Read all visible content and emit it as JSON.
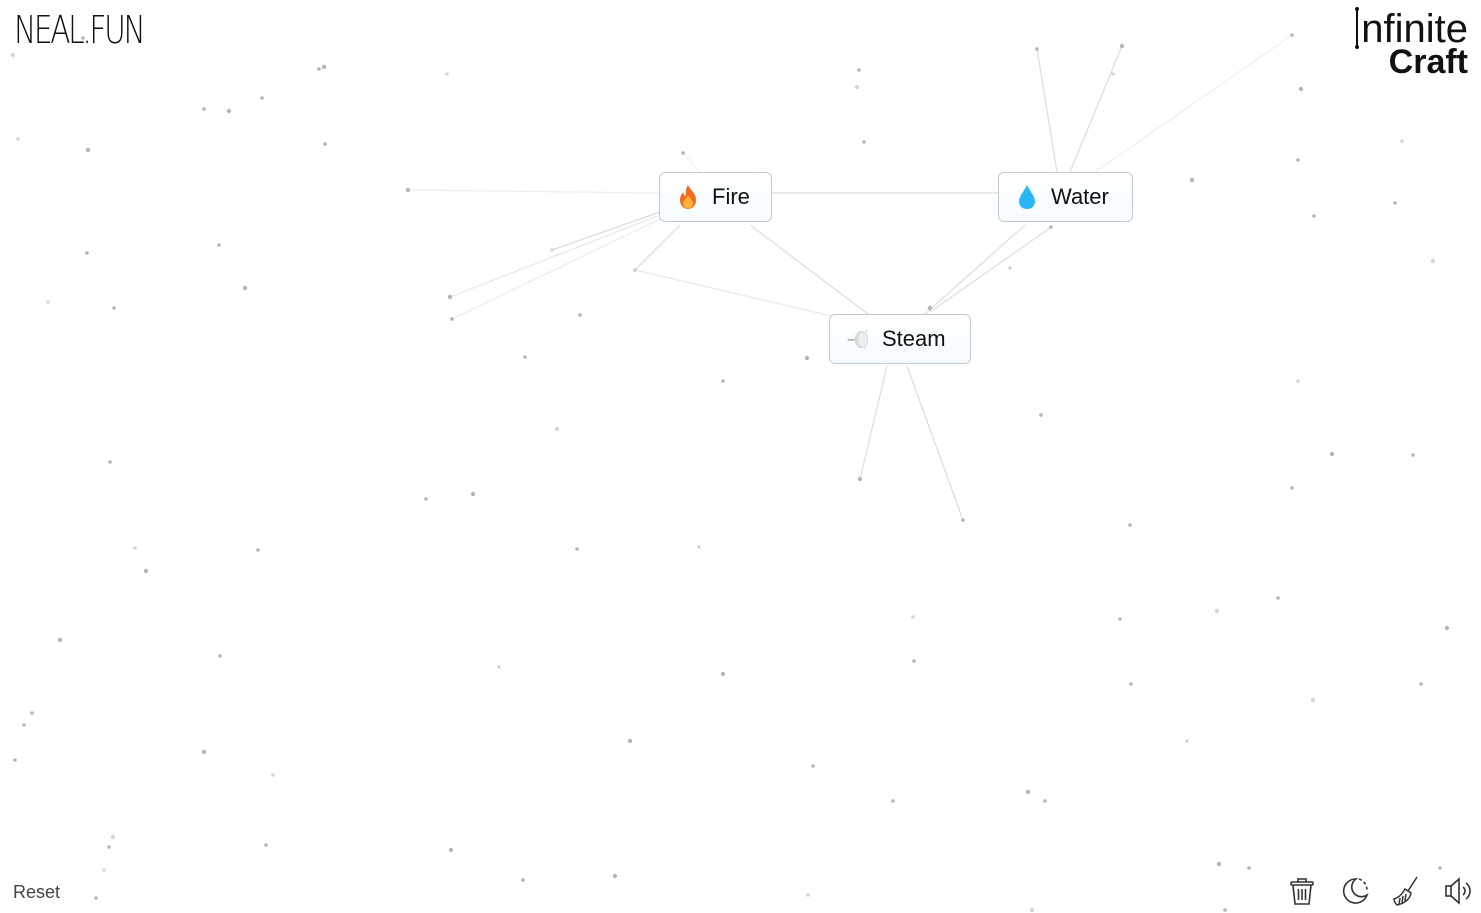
{
  "header": {
    "site_logo": "NEAL.FUN",
    "app_title_line1": "nfinite",
    "app_title_line2": "Craft"
  },
  "items": [
    {
      "label": "Fire",
      "icon": "fire-icon",
      "emoji": "🔥"
    },
    {
      "label": "Water",
      "icon": "water-drop-icon",
      "emoji": "💧"
    },
    {
      "label": "Steam",
      "icon": "steam-icon",
      "emoji": "🌫"
    }
  ],
  "footer": {
    "reset_label": "Reset",
    "tools": [
      {
        "name": "trash-icon",
        "title": "Clear"
      },
      {
        "name": "moon-icon",
        "title": "Dark mode"
      },
      {
        "name": "broom-icon",
        "title": "Clean up"
      },
      {
        "name": "speaker-icon",
        "title": "Sound"
      }
    ]
  },
  "colors": {
    "fire": "#f58220",
    "water": "#29b6f6",
    "steam": "#cfd2d4",
    "item_border": "#c4c9cf",
    "line": "#d9d9d9"
  }
}
